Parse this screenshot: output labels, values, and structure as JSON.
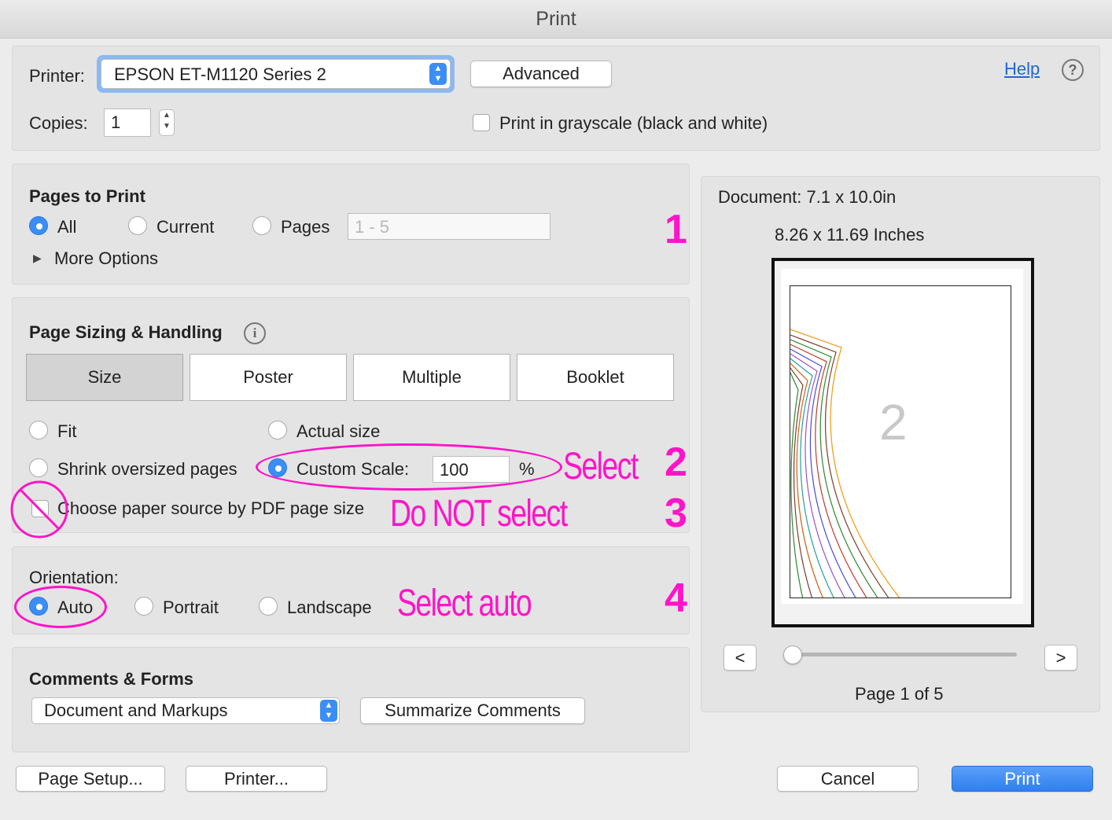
{
  "window": {
    "title": "Print"
  },
  "header": {
    "printer_label": "Printer:",
    "printer_value": "EPSON ET-M1120 Series 2",
    "advanced_label": "Advanced",
    "help_label": "Help",
    "copies_label": "Copies:",
    "copies_value": "1",
    "grayscale_label": "Print in grayscale (black and white)"
  },
  "pages_to_print": {
    "title": "Pages to Print",
    "all_label": "All",
    "current_label": "Current",
    "pages_label": "Pages",
    "pages_value": "1 - 5",
    "more_options_label": "More Options"
  },
  "page_sizing": {
    "title": "Page Sizing & Handling",
    "tabs": [
      "Size",
      "Poster",
      "Multiple",
      "Booklet"
    ],
    "fit_label": "Fit",
    "actual_size_label": "Actual size",
    "shrink_label": "Shrink oversized pages",
    "custom_scale_label": "Custom Scale:",
    "custom_scale_value": "100",
    "percent_label": "%",
    "paper_source_label": "Choose paper source by PDF page size"
  },
  "orientation": {
    "title": "Orientation:",
    "auto_label": "Auto",
    "portrait_label": "Portrait",
    "landscape_label": "Landscape"
  },
  "comments": {
    "title": "Comments & Forms",
    "select_value": "Document and Markups",
    "summarize_label": "Summarize Comments"
  },
  "preview": {
    "document_label": "Document: 7.1 x 10.0in",
    "paper_label": "8.26 x 11.69 Inches",
    "page_number_glyph": "2",
    "prev_label": "<",
    "next_label": ">",
    "page_indicator": "Page 1 of 5"
  },
  "footer": {
    "page_setup_label": "Page Setup...",
    "printer_label": "Printer...",
    "cancel_label": "Cancel",
    "print_label": "Print"
  },
  "annotations": {
    "n1": "1",
    "n2": "2",
    "n3": "3",
    "n4": "4",
    "select": "Select",
    "do_not_select": "Do NOT select",
    "select_auto": "Select auto"
  },
  "colors": {
    "accent": "#3b8ef5",
    "annotation": "#ff14c8",
    "print_button": "#2f7ff0"
  }
}
